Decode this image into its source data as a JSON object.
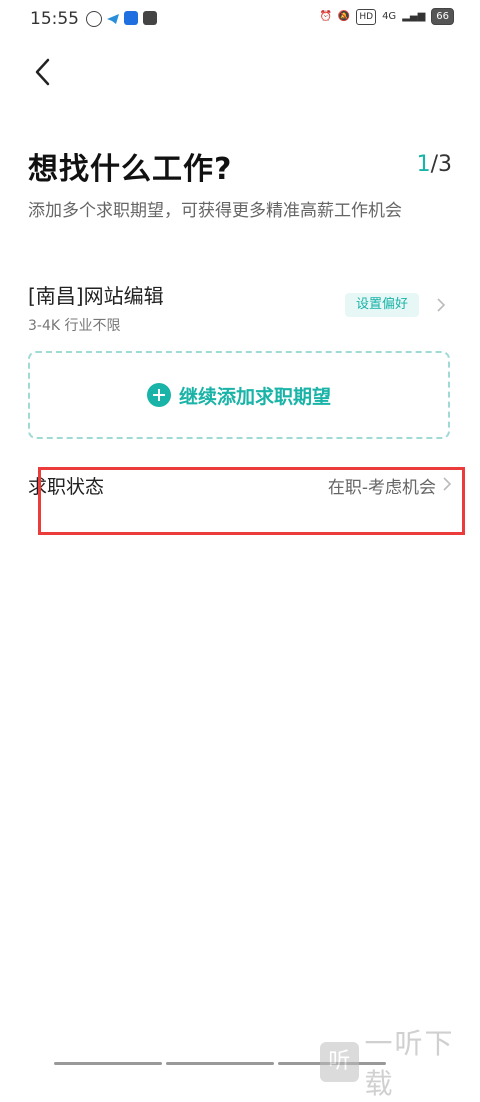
{
  "status_bar": {
    "time": "15:55",
    "signal": "4G",
    "battery": "66"
  },
  "header": {
    "title": "想找什么工作?",
    "step_current": "1",
    "step_total": "/3",
    "subtitle": "添加多个求职期望，可获得更多精准高薪工作机会"
  },
  "expectation": {
    "title": "[南昌]网站编辑",
    "detail": "3-4K 行业不限",
    "pref_label": "设置偏好"
  },
  "add_button": {
    "label": "继续添加求职期望"
  },
  "job_status": {
    "label": "求职状态",
    "value": "在职-考虑机会"
  },
  "watermark": {
    "logo_char": "听",
    "text": "一听下载"
  },
  "colors": {
    "accent": "#19b3a7",
    "highlight": "#ec3b3b"
  }
}
